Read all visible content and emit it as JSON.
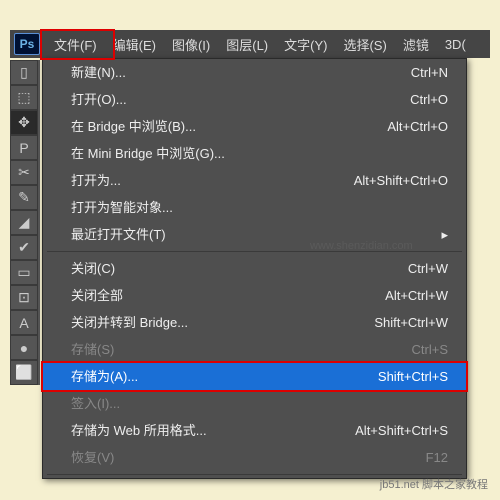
{
  "logo": "Ps",
  "menubar": [
    "文件(F)",
    "编辑(E)",
    "图像(I)",
    "图层(L)",
    "文字(Y)",
    "选择(S)",
    "滤镜",
    "3D("
  ],
  "menu": {
    "new": "新建(N)...",
    "new_sc": "Ctrl+N",
    "open": "打开(O)...",
    "open_sc": "Ctrl+O",
    "browse": "在 Bridge 中浏览(B)...",
    "browse_sc": "Alt+Ctrl+O",
    "mini": "在 Mini Bridge 中浏览(G)...",
    "openas": "打开为...",
    "openas_sc": "Alt+Shift+Ctrl+O",
    "opensmart": "打开为智能对象...",
    "recent": "最近打开文件(T)",
    "close": "关闭(C)",
    "close_sc": "Ctrl+W",
    "closeall": "关闭全部",
    "closeall_sc": "Alt+Ctrl+W",
    "closebridge": "关闭并转到 Bridge...",
    "closebridge_sc": "Shift+Ctrl+W",
    "save": "存储(S)",
    "save_sc": "Ctrl+S",
    "saveas": "存储为(A)...",
    "saveas_sc": "Shift+Ctrl+S",
    "checkin": "签入(I)...",
    "saveweb": "存储为 Web 所用格式...",
    "saveweb_sc": "Alt+Shift+Ctrl+S",
    "revert": "恢复(V)",
    "revert_sc": "F12"
  },
  "tools": [
    "▯",
    "⬚",
    "✥",
    "P",
    "✂",
    "✎",
    "◢",
    "✔",
    "▭",
    "⊡",
    "A",
    "●",
    "⬜"
  ],
  "watermarks": {
    "top": "www.shenzidian.com",
    "url": "jb51.net",
    "text": "脚本之家教程"
  }
}
